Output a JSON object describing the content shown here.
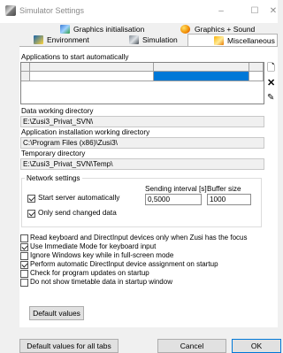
{
  "window": {
    "title": "Simulator Settings",
    "minimize": "–",
    "maximize": "☐",
    "close": "✕"
  },
  "tabs": {
    "back_row": [
      {
        "label": "Graphics initialisation",
        "icon": "graphics-icon"
      },
      {
        "label": "Graphics + Sound",
        "icon": "palette-icon"
      }
    ],
    "front_row": [
      {
        "label": "Environment",
        "icon": "environment-icon"
      },
      {
        "label": "Simulation",
        "icon": "simulation-icon"
      },
      {
        "label": "Miscellaneous",
        "icon": "miscellaneous-icon",
        "active": true
      }
    ]
  },
  "apps": {
    "label": "Applications to start automatically",
    "side_buttons": {
      "new": "🗋",
      "delete": "✕",
      "edit": "✎"
    }
  },
  "paths": {
    "data_dir_label": "Data working directory",
    "data_dir_value": "E:\\Zusi3_Privat_SVN\\",
    "install_dir_label": "Application installation working directory",
    "install_dir_value": "C:\\Program Files (x86)\\Zusi3\\",
    "temp_dir_label": "Temporary directory",
    "temp_dir_value": "E:\\Zusi3_Privat_SVN\\Temp\\"
  },
  "network": {
    "group_label": "Network settings",
    "start_server_label": "Start server automatically",
    "start_server_checked": true,
    "only_changed_label": "Only send changed data",
    "only_changed_checked": true,
    "interval_label": "Sending interval [s]",
    "interval_value": "0,5000",
    "buffer_label": "Buffer size",
    "buffer_value": "1000"
  },
  "options": [
    {
      "label": "Read keyboard and DirectInput devices only when Zusi has the focus",
      "checked": false
    },
    {
      "label": "Use Immediate Mode for keyboard input",
      "checked": true
    },
    {
      "label": "Ignore Windows key while in full-screen mode",
      "checked": false
    },
    {
      "label": "Perform automatic DirectInput device assignment on startup",
      "checked": true
    },
    {
      "label": "Check for program updates on startup",
      "checked": false
    },
    {
      "label": "Do not show timetable data in startup window",
      "checked": false
    }
  ],
  "buttons": {
    "default_values": "Default values",
    "default_all_tabs": "Default values for all tabs",
    "cancel": "Cancel",
    "ok": "OK"
  },
  "colors": {
    "selection": "#0078d7",
    "accent_border": "#0078d7"
  }
}
